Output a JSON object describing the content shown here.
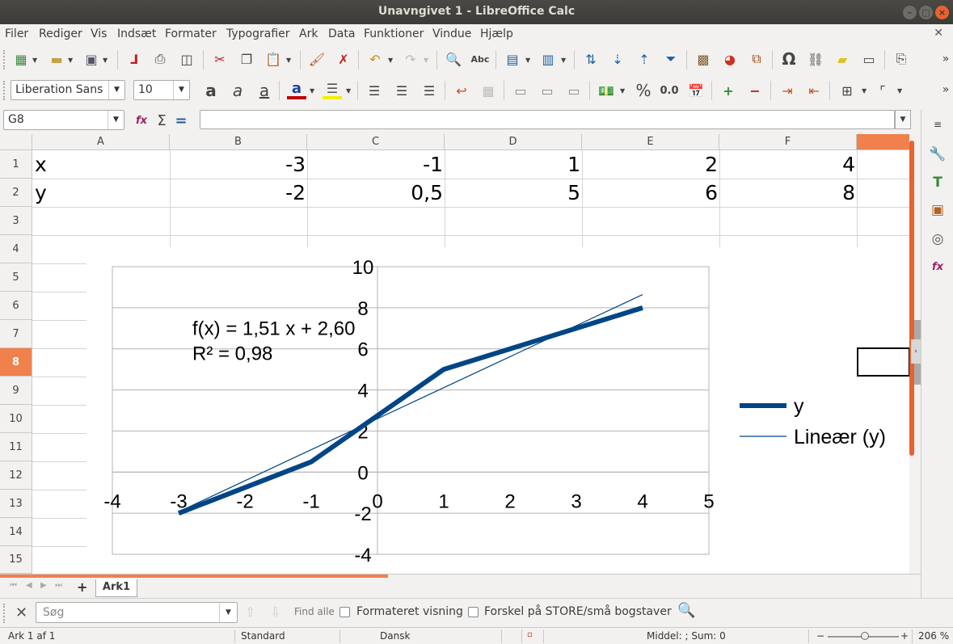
{
  "window": {
    "title": "Unavngivet 1 - LibreOffice Calc"
  },
  "menu": [
    "Filer",
    "Rediger",
    "Vis",
    "Indsæt",
    "Formater",
    "Typografier",
    "Ark",
    "Data",
    "Funktioner",
    "Vindue",
    "Hjælp"
  ],
  "format_toolbar": {
    "font_name": "Liberation Sans",
    "font_size": "10",
    "percent": "%",
    "decimal": "0.0"
  },
  "formula_bar": {
    "name_box": "G8",
    "formula": ""
  },
  "columns": [
    "A",
    "B",
    "C",
    "D",
    "E",
    "F"
  ],
  "rows": [
    "1",
    "2",
    "3",
    "4",
    "5",
    "6",
    "7",
    "8",
    "9",
    "10",
    "11",
    "12",
    "13",
    "14",
    "15"
  ],
  "active_row": "8",
  "cells": {
    "row1": [
      "x",
      "-3",
      "-1",
      "1",
      "2",
      "4"
    ],
    "row2": [
      "y",
      "-2",
      "0,5",
      "5",
      "6",
      "8"
    ]
  },
  "chart_data": {
    "type": "line",
    "x": [
      -3,
      -1,
      1,
      2,
      4
    ],
    "series": [
      {
        "name": "y",
        "values": [
          -2,
          0.5,
          5,
          6,
          8
        ],
        "color": "#004586"
      },
      {
        "name": "Lineær (y)",
        "trendline": {
          "slope": 1.51,
          "intercept": 2.6
        },
        "color": "#004586"
      }
    ],
    "xlim": [
      -4,
      5
    ],
    "ylim": [
      -4,
      10
    ],
    "x_ticks": [
      "-4",
      "-3",
      "-2",
      "-1",
      "0",
      "1",
      "2",
      "3",
      "4",
      "5"
    ],
    "y_ticks": [
      "-4",
      "-2",
      "0",
      "2",
      "4",
      "6",
      "8",
      "10"
    ],
    "equation": "f(x) = 1,51 x + 2,60",
    "r_squared": "R² = 0,98",
    "grid": true,
    "legend": "right"
  },
  "sheet_tabs": {
    "active": "Ark1"
  },
  "find_bar": {
    "search_placeholder": "Søg",
    "find_all": "Find alle",
    "formatted_display": "Formateret visning",
    "match_case": "Forskel på STORE/små bogstaver"
  },
  "status": {
    "sheet": "Ark 1 af 1",
    "page_style": "Standard",
    "language": "Dansk",
    "summary": "Middel: ; Sum: 0",
    "zoom": "206 %"
  },
  "colors": {
    "accent": "#e9612f",
    "active_header": "#f0804c",
    "series": "#004586"
  }
}
